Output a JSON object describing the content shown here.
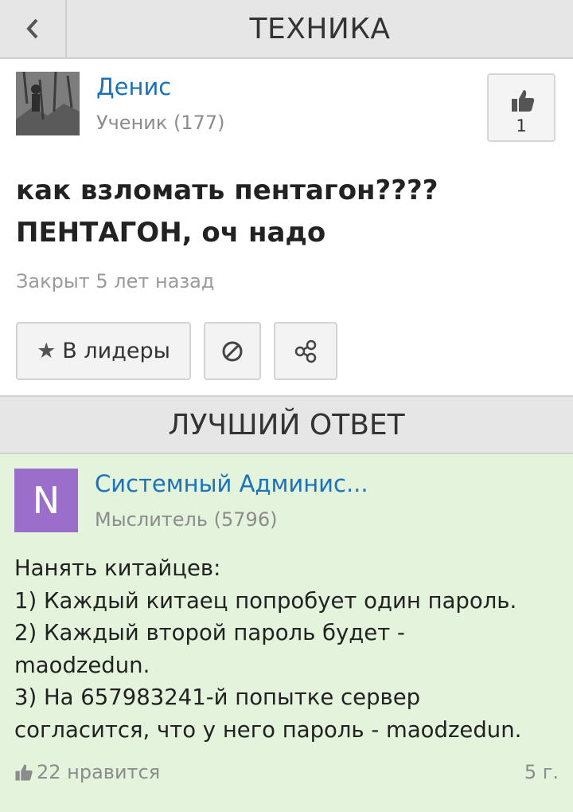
{
  "header": {
    "back_icon": "chevron-left-icon",
    "title": "ТЕХНИКА"
  },
  "question": {
    "author": "Денис",
    "rank": "Ученик (177)",
    "likes": "1",
    "like_icon": "thumbs-up-icon",
    "title_line1": "как взломать пентагон????",
    "title_line2": "ПЕНТАГОН, оч надо",
    "status": "Закрыт 5 лет назад",
    "leaders_button": "В лидеры",
    "leaders_icon": "star-icon",
    "block_icon": "block-icon",
    "share_icon": "share-icon"
  },
  "best_answer": {
    "section_title": "ЛУЧШИЙ ОТВЕТ",
    "avatar_letter": "N",
    "avatar_color": "#9b6ecb",
    "author": "Системный Админис...",
    "rank": "Мыслитель (5796)",
    "lines": [
      "Нанять китайцев:",
      "1) Каждый китаец попробует один пароль.",
      "2) Каждый второй пароль будет -",
      "maodzedun.",
      "3) На 657983241-й попытке сервер",
      "согласится, что у него пароль - maodzedun."
    ],
    "likes": "22 нравится",
    "time": "5 г."
  },
  "colors": {
    "link": "#1a73b8",
    "answer_bg": "#e4f3dc",
    "header_bg": "#e6e6e6"
  }
}
